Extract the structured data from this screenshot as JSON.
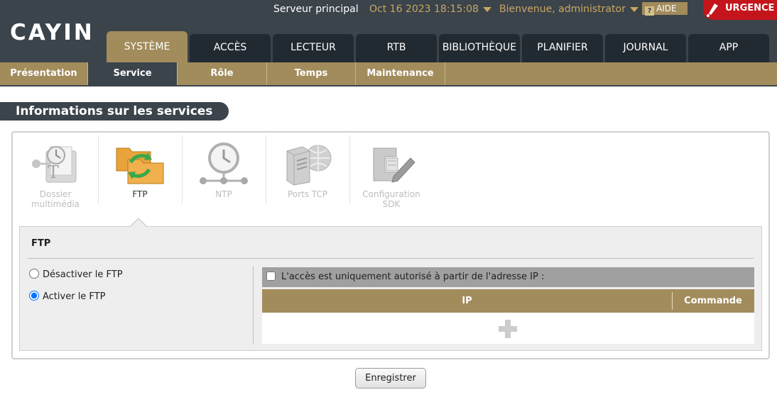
{
  "header": {
    "logo_text": "CAYIN",
    "server_label": "Serveur principal",
    "datetime": "Oct 16 2023 18:15:08",
    "welcome": "Bienvenue, administrator",
    "help_label": "AIDE",
    "urgence_label": "URGENCE"
  },
  "main_tabs": [
    {
      "label": "SYSTÈME"
    },
    {
      "label": "ACCÈS"
    },
    {
      "label": "LECTEUR"
    },
    {
      "label": "RTB"
    },
    {
      "label": "BIBLIOTHÈQUE"
    },
    {
      "label": "PLANIFIER"
    },
    {
      "label": "JOURNAL"
    },
    {
      "label": "APP"
    }
  ],
  "active_main_tab": "SYSTÈME",
  "sub_tabs": [
    {
      "label": "Présentation"
    },
    {
      "label": "Service"
    },
    {
      "label": "Rôle"
    },
    {
      "label": "Temps"
    },
    {
      "label": "Maintenance"
    }
  ],
  "active_sub_tab": "Service",
  "section_title": "Informations sur les services",
  "services": [
    {
      "label_line1": "Dossier",
      "label_line2": "multimédia",
      "icon": "media-folder-icon"
    },
    {
      "label_line1": "FTP",
      "label_line2": "",
      "icon": "ftp-folders-icon"
    },
    {
      "label_line1": "NTP",
      "label_line2": "",
      "icon": "ntp-clock-icon"
    },
    {
      "label_line1": "Ports TCP",
      "label_line2": "",
      "icon": "tcp-server-icon"
    },
    {
      "label_line1": "Configuration",
      "label_line2": "SDK",
      "icon": "sdk-config-icon"
    }
  ],
  "active_service": "FTP",
  "ftp_panel": {
    "title": "FTP",
    "disable_label": "Désactiver le FTP",
    "enable_label": "Activer le FTP",
    "selected": "enable",
    "ip_restrict_label": "L'accès est uniquement autorisé à partir de l'adresse IP :",
    "ip_restrict_checked": false,
    "col_ip": "IP",
    "col_command": "Commande"
  },
  "save_label": "Enregistrer",
  "colors": {
    "header_bg": "#3b434b",
    "accent_gold": "#a28c5c",
    "highlight_text": "#c9a760",
    "urgence_red": "#c4141c"
  }
}
